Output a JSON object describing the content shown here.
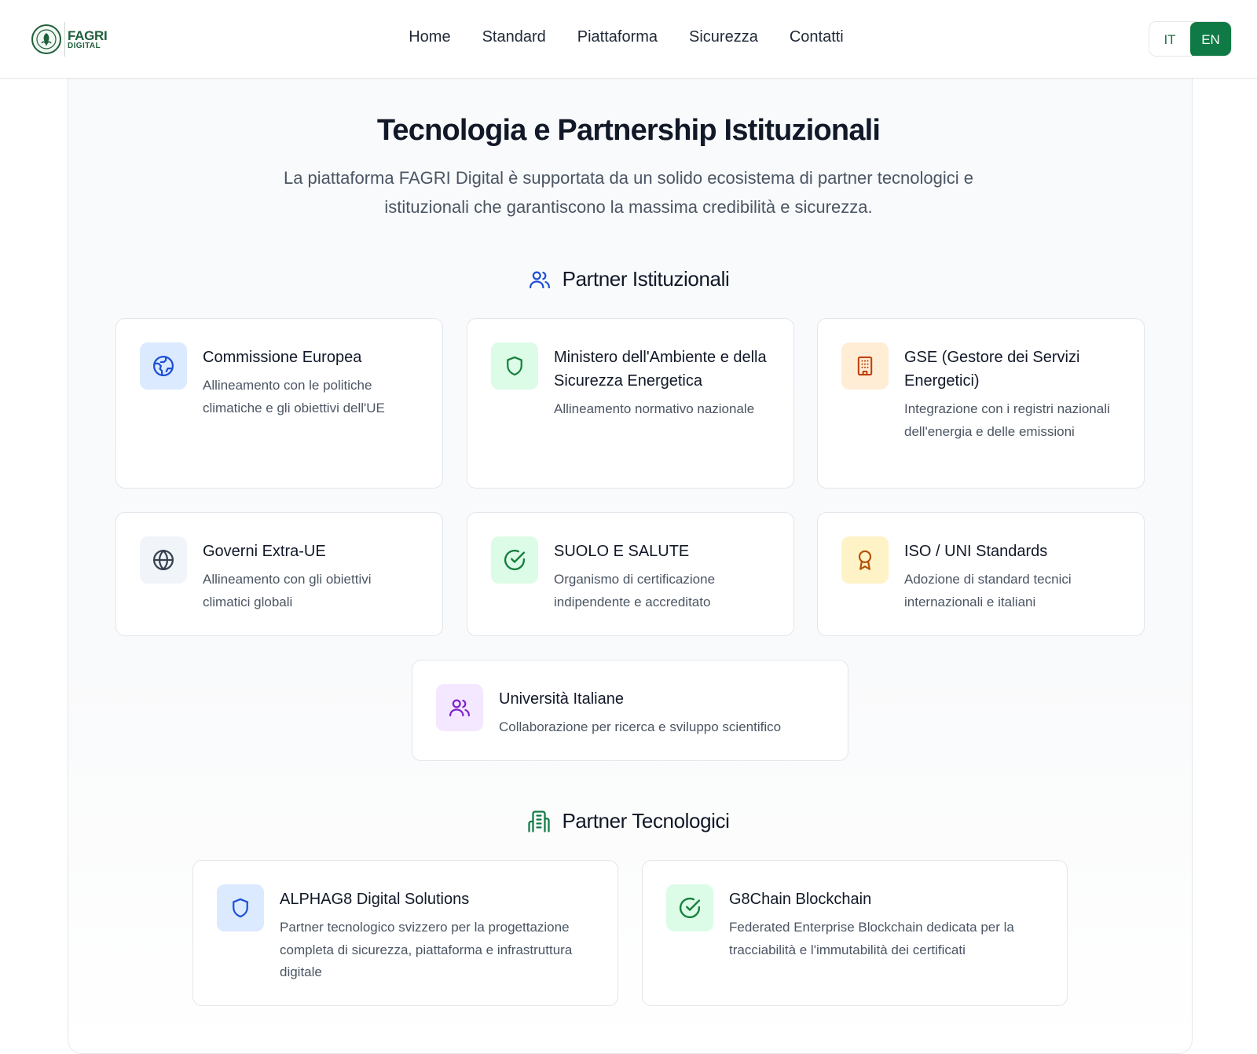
{
  "header": {
    "logo": {
      "line1": "FAGRI",
      "line2": "DIGITAL"
    },
    "nav": [
      "Home",
      "Standard",
      "Piattaforma",
      "Sicurezza",
      "Contatti"
    ],
    "lang": {
      "it": "IT",
      "en": "EN",
      "active": "EN"
    }
  },
  "main": {
    "title": "Tecnologia e Partnership Istituzionali",
    "subtitle": "La piattaforma FAGRI Digital è supportata da un solido ecosistema di partner tecnologici e istituzionali che garantiscono la massima credibilità e sicurezza."
  },
  "institutional": {
    "heading": "Partner Istituzionali",
    "icon": "users-icon",
    "cards": [
      {
        "title": "Commissione Europea",
        "desc": "Allineamento con le politiche climatiche e gli obiettivi dell'UE",
        "icon": "earth-icon",
        "icon_color": "#1d4ed8",
        "bg": "#dbeafe"
      },
      {
        "title": "Ministero dell'Ambiente e della Sicurezza Energetica",
        "desc": "Allineamento normativo nazionale",
        "icon": "shield-icon",
        "icon_color": "#15803d",
        "bg": "#dcfce7"
      },
      {
        "title": "GSE (Gestore dei Servizi Energetici)",
        "desc": "Integrazione con i registri nazionali dell'energia e delle emissioni",
        "icon": "building-icon",
        "icon_color": "#c2410c",
        "bg": "#ffedd5"
      },
      {
        "title": "Governi Extra-UE",
        "desc": "Allineamento con gli obiettivi climatici globali",
        "icon": "globe-icon",
        "icon_color": "#374151",
        "bg": "#f1f5f9"
      },
      {
        "title": "SUOLO E SALUTE",
        "desc": "Organismo di certificazione indipendente e accreditato",
        "icon": "check-circle-icon",
        "icon_color": "#15803d",
        "bg": "#dcfce7"
      },
      {
        "title": "ISO / UNI Standards",
        "desc": "Adozione di standard tecnici internazionali e italiani",
        "icon": "award-icon",
        "icon_color": "#b45309",
        "bg": "#fef3c7"
      },
      {
        "title": "Università Italiane",
        "desc": "Collaborazione per ricerca e sviluppo scientifico",
        "icon": "users-icon",
        "icon_color": "#7e22ce",
        "bg": "#f3e8ff"
      }
    ]
  },
  "technology": {
    "heading": "Partner Tecnologici",
    "icon": "building-icon",
    "cards": [
      {
        "title": "ALPHAG8 Digital Solutions",
        "desc": "Partner tecnologico svizzero per la progettazione completa di sicurezza, piattaforma e infrastruttura digitale",
        "icon": "shield-icon",
        "icon_color": "#1d4ed8",
        "bg": "#dbeafe"
      },
      {
        "title": "G8Chain Blockchain",
        "desc": "Federated Enterprise Blockchain dedicata per la tracciabilità e l'immutabilità dei certificati",
        "icon": "check-circle-icon",
        "icon_color": "#15803d",
        "bg": "#dcfce7"
      }
    ]
  }
}
